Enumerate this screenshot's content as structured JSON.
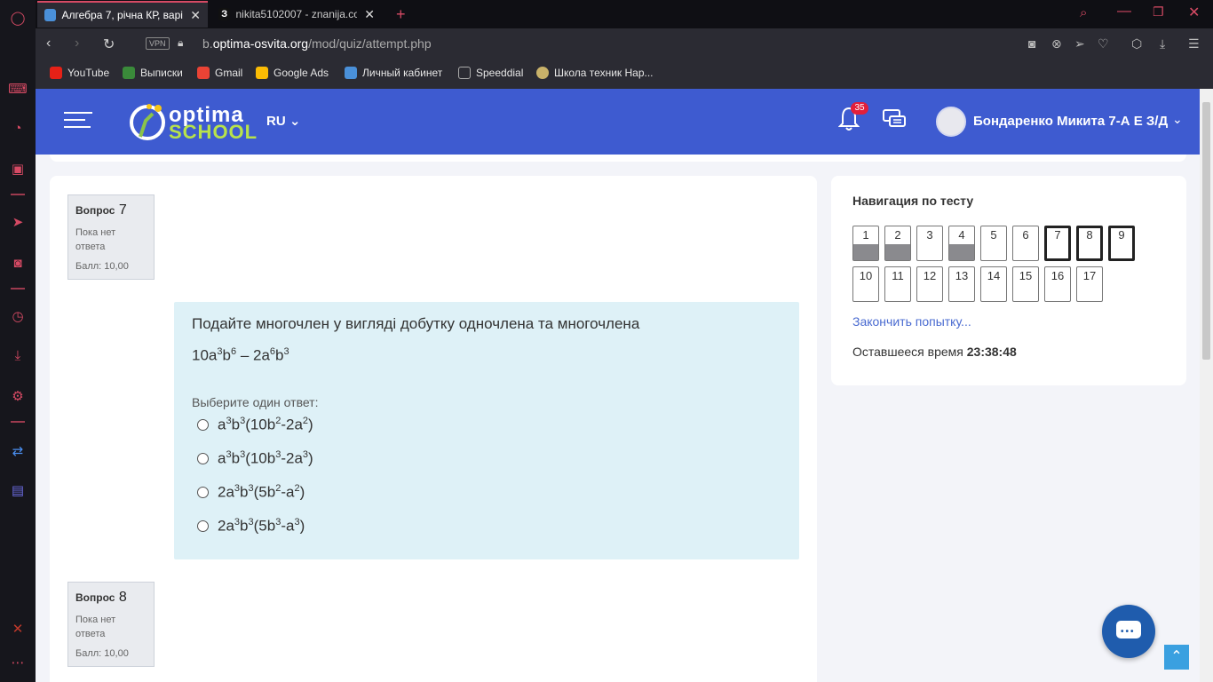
{
  "browser": {
    "tabs": [
      {
        "label": "Алгебра 7, річна КР, варіа",
        "active": true
      },
      {
        "label": "nikita5102007 - znanija.com",
        "active": false
      }
    ],
    "new_tab": "+",
    "url_prefix": "b.",
    "url_host": "optima-osvita.org",
    "url_path": "/mod/quiz/attempt.php",
    "vpn_label": "VPN",
    "bookmarks": [
      "YouTube",
      "Выписки",
      "Gmail",
      "Google Ads",
      "Личный кабинет",
      "Speeddial",
      "Школа техник Нар..."
    ]
  },
  "header": {
    "logo_line1": "optima",
    "logo_line2": "SCHOOL",
    "lang": "RU",
    "notifications_count": "35",
    "username": "Бондаренко Микита 7-А Е З/Д"
  },
  "questions": [
    {
      "title": "Вопрос",
      "number": "7",
      "state": "Пока нет ответа",
      "grade": "Балл: 10,00"
    },
    {
      "title": "Вопрос",
      "number": "8",
      "state": "Пока нет ответа",
      "grade": "Балл: 10,00"
    }
  ],
  "question7": {
    "text": "Подайте многочлен у вигляді добутку одночлена та многочлена",
    "prompt": "Выберите один ответ:"
  },
  "nav": {
    "title": "Навигация по тесту",
    "buttons": [
      {
        "label": "1",
        "answered": true,
        "current": false
      },
      {
        "label": "2",
        "answered": true,
        "current": false
      },
      {
        "label": "3",
        "answered": false,
        "current": false
      },
      {
        "label": "4",
        "answered": true,
        "current": false
      },
      {
        "label": "5",
        "answered": false,
        "current": false
      },
      {
        "label": "6",
        "answered": false,
        "current": false
      },
      {
        "label": "7",
        "answered": false,
        "current": true
      },
      {
        "label": "8",
        "answered": false,
        "current": true
      },
      {
        "label": "9",
        "answered": false,
        "current": true
      },
      {
        "label": "10",
        "answered": false,
        "current": false
      },
      {
        "label": "11",
        "answered": false,
        "current": false
      },
      {
        "label": "12",
        "answered": false,
        "current": false
      },
      {
        "label": "13",
        "answered": false,
        "current": false
      },
      {
        "label": "14",
        "answered": false,
        "current": false
      },
      {
        "label": "15",
        "answered": false,
        "current": false
      },
      {
        "label": "16",
        "answered": false,
        "current": false
      },
      {
        "label": "17",
        "answered": false,
        "current": false
      }
    ],
    "finish_label": "Закончить попытку...",
    "time_label": "Оставшееся время",
    "time_value": "23:38:48"
  },
  "colors": {
    "header_bg": "#3e5bd0",
    "accent": "#d64a64",
    "question_bg": "#def1f7"
  }
}
